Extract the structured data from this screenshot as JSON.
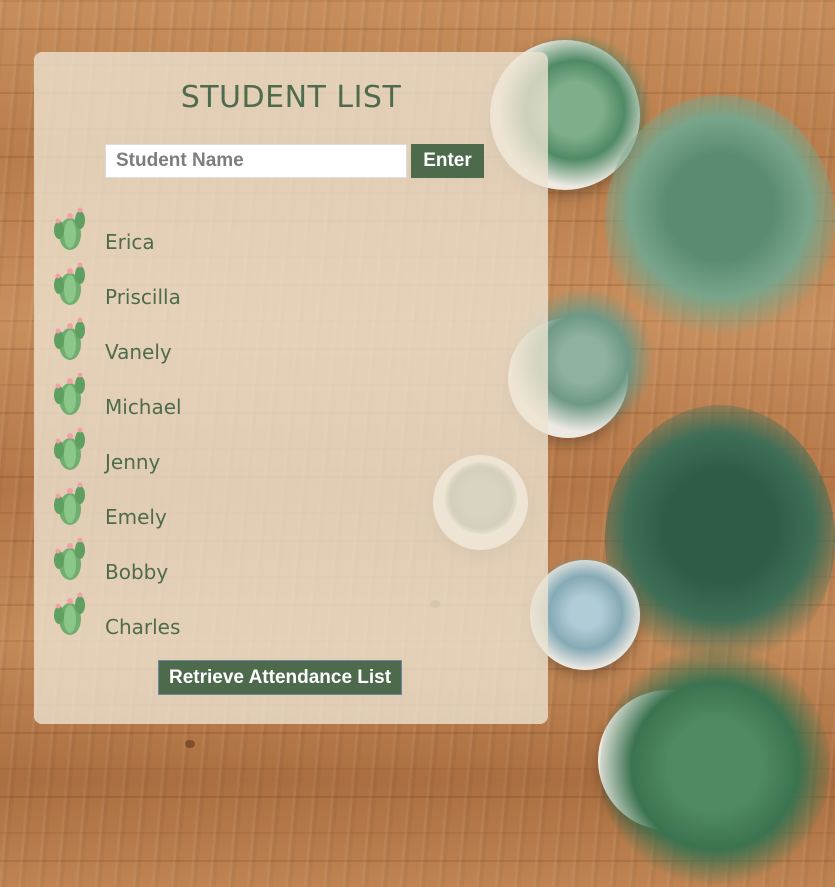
{
  "title": "STUDENT LIST",
  "search": {
    "placeholder": "Student Name",
    "value": ""
  },
  "enter_label": "Enter",
  "students": [
    {
      "name": "Erica"
    },
    {
      "name": "Priscilla"
    },
    {
      "name": "Vanely"
    },
    {
      "name": "Michael"
    },
    {
      "name": "Jenny"
    },
    {
      "name": "Emely"
    },
    {
      "name": "Bobby"
    },
    {
      "name": "Charles"
    }
  ],
  "retrieve_label": "Retrieve Attendance List",
  "icons": {
    "student": "cactus-icon"
  },
  "colors": {
    "accent": "#4d6b4c",
    "text": "#4f6b4d",
    "panel": "#ece2d0",
    "cactus": "#6fae6f",
    "flower": "#f2a0a8"
  }
}
